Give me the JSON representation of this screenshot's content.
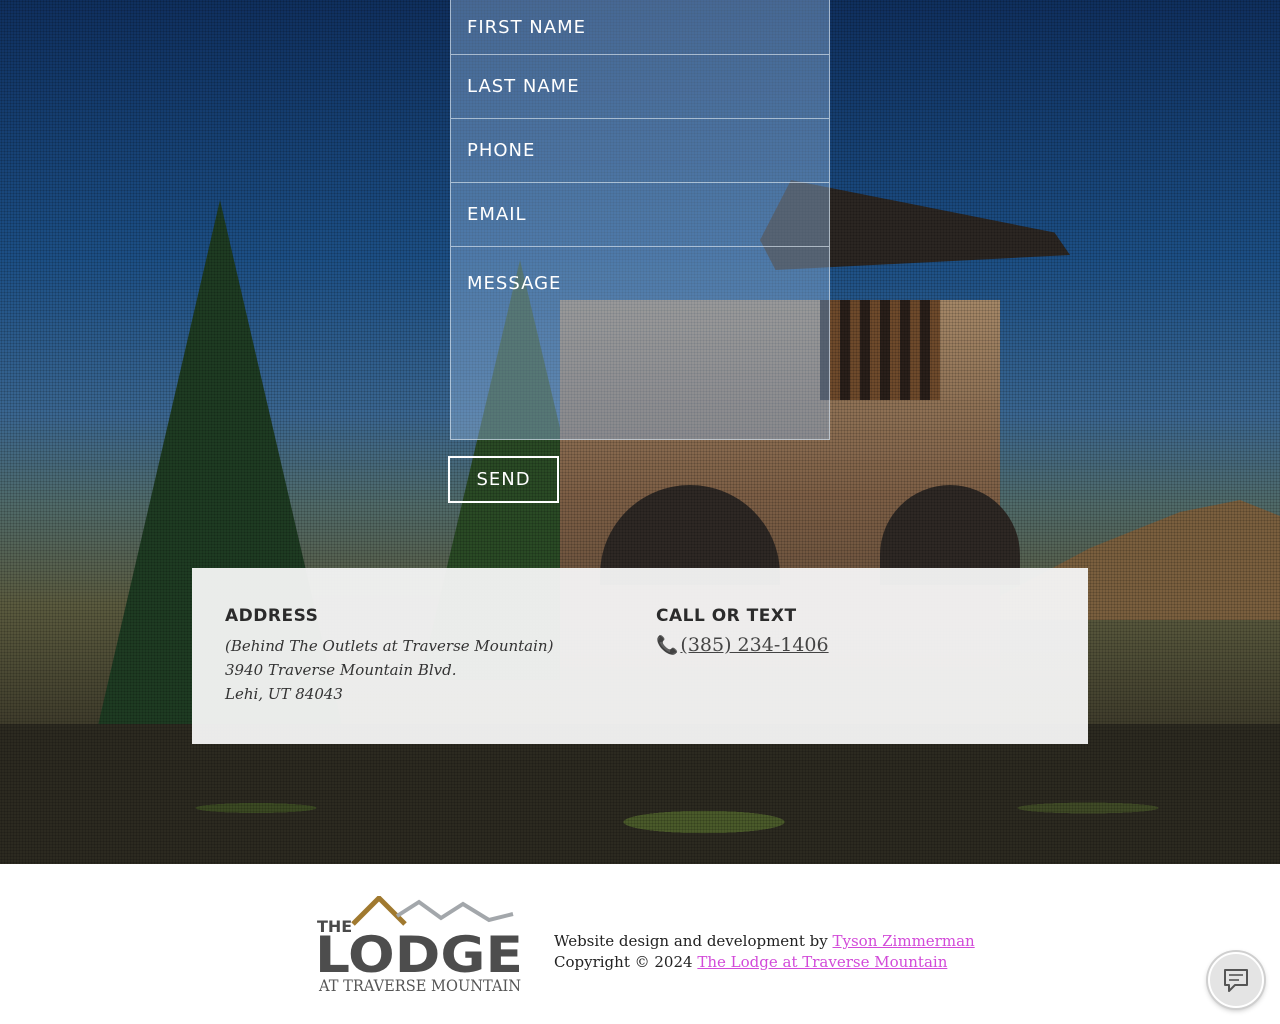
{
  "form": {
    "first_name_placeholder": "FIRST NAME",
    "last_name_placeholder": "LAST NAME",
    "phone_placeholder": "PHONE",
    "email_placeholder": "EMAIL",
    "message_placeholder": "MESSAGE",
    "send_label": "SEND"
  },
  "contact": {
    "address_heading": "ADDRESS",
    "address_lines": [
      "(Behind The Outlets at Traverse Mountain)",
      "3940 Traverse Mountain Blvd.",
      "Lehi, UT 84043"
    ],
    "call_heading": "CALL OR TEXT",
    "phone": "(385) 234-1406",
    "phone_icon": "phone-icon"
  },
  "footer": {
    "logo": {
      "line1": "THE",
      "line2": "LODGE",
      "line3": "AT TRAVERSE MOUNTAIN"
    },
    "credit_prefix": "Website design and development by",
    "credit_link": "Tyson Zimmerman",
    "copyright_prefix": "Copyright © 2024",
    "copyright_link": "The Lodge at Traverse Mountain",
    "link_color": "#d24ad9"
  },
  "chat": {
    "icon": "chat-bubble-icon"
  }
}
